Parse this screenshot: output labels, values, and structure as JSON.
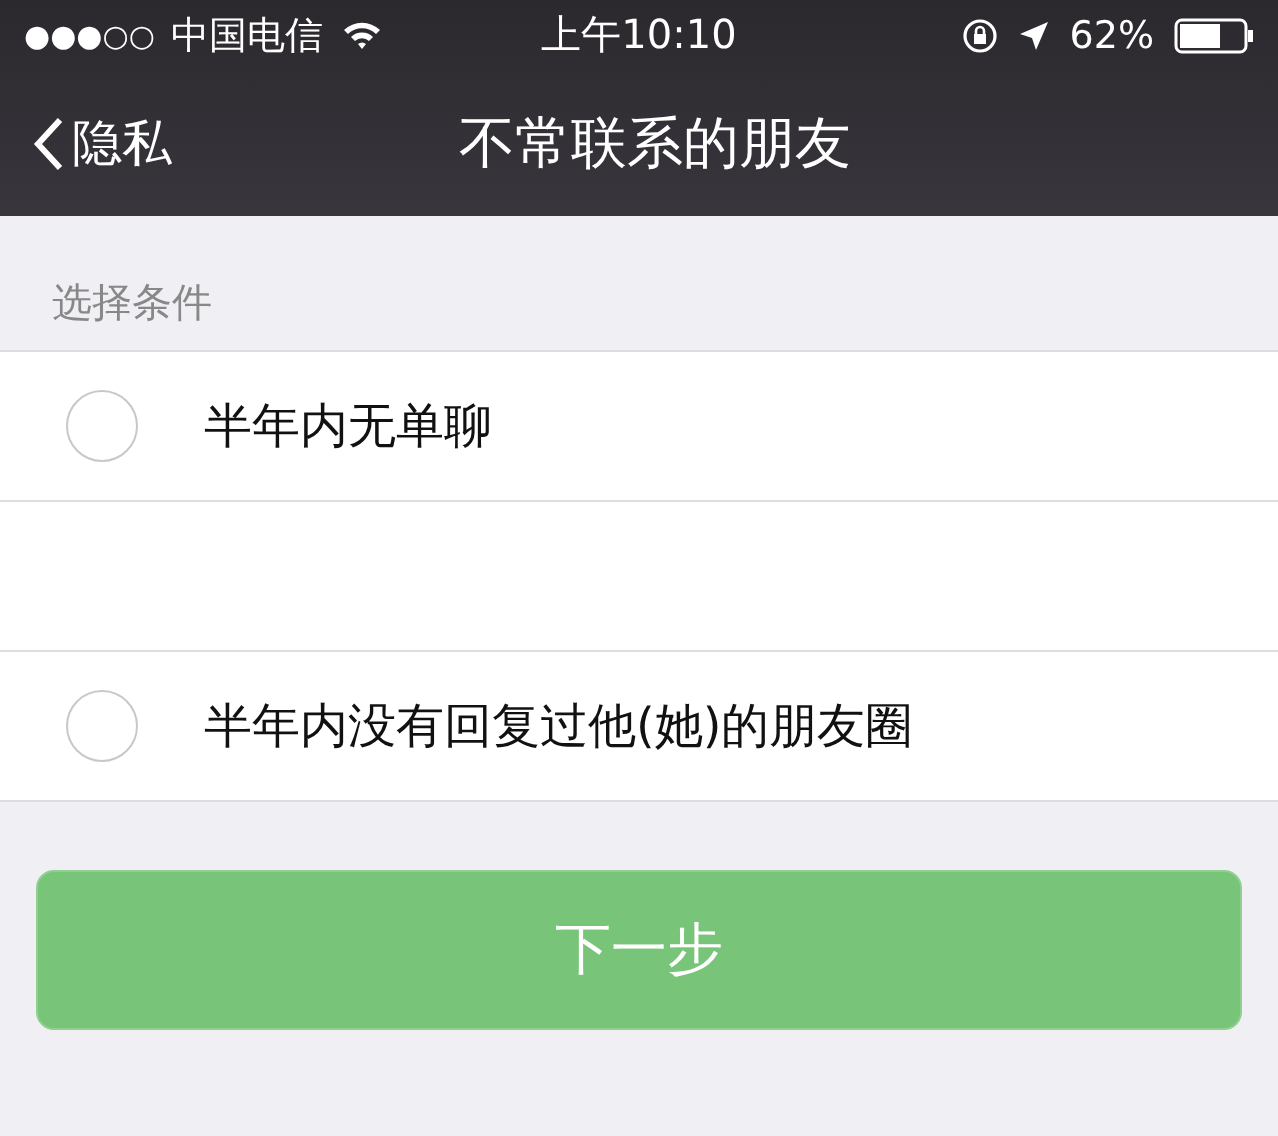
{
  "status_bar": {
    "signal": "●●●○○",
    "carrier": "中国电信",
    "time": "上午10:10",
    "battery_percent": "62%"
  },
  "nav_bar": {
    "back_label": "隐私",
    "title": "不常联系的朋友"
  },
  "section": {
    "label": "选择条件"
  },
  "options": [
    {
      "kind": "option",
      "label": "半年内无单聊",
      "selected": false
    },
    {
      "kind": "blank"
    },
    {
      "kind": "option",
      "label": "半年内没有回复过他(她)的朋友圈",
      "selected": false
    }
  ],
  "next_button": {
    "label": "下一步",
    "disabled": true
  }
}
